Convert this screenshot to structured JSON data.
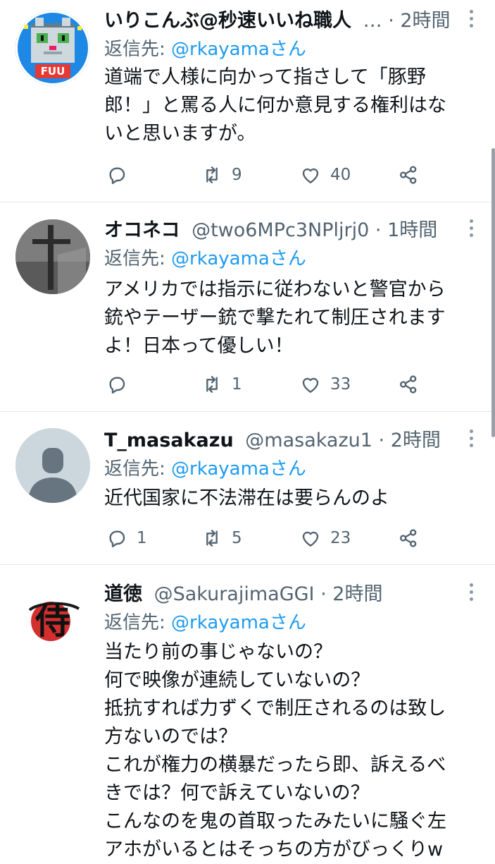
{
  "reply_prefix": "返信先: ",
  "tweets": [
    {
      "name": "いりこんぶ@秒速いいね職人",
      "handle": "…",
      "time": "2時間",
      "reply_to": "@rkayamaさん",
      "lines": [
        "道端で人様に向かって指さして「豚野",
        "郎！」と罵る人に何か意見する権利はな",
        "いと思いますが。"
      ],
      "reply_count": "",
      "retweet_count": "9",
      "like_count": "40"
    },
    {
      "name": "オコネコ",
      "handle": "@two6MPc3NPljrj0",
      "time": "1時間",
      "reply_to": "@rkayamaさん",
      "lines": [
        "アメリカでは指示に従わないと警官から",
        "銃やテーザー銃で撃たれて制圧されます",
        "よ！日本って優しい！"
      ],
      "reply_count": "",
      "retweet_count": "1",
      "like_count": "33"
    },
    {
      "name": "T_masakazu",
      "handle": "@masakazu1",
      "time": "2時間",
      "reply_to": "@rkayamaさん",
      "lines": [
        "近代国家に不法滞在は要らんのよ"
      ],
      "reply_count": "1",
      "retweet_count": "5",
      "like_count": "23"
    },
    {
      "name": "道徳",
      "handle": "@SakurajimaGGI",
      "time": "2時間",
      "reply_to": "@rkayamaさん",
      "lines": [
        "当たり前の事じゃないの？",
        "何で映像が連続していないの？",
        "抵抗すれば力ずくで制圧されるのは致し",
        "方ないのでは？",
        "これが権力の横暴だったら即、訴えるべ",
        "きでは？何で訴えていないの？",
        "こんなのを鬼の首取ったみたいに騒ぐ左",
        "アホがいるとはそっちの方がびっくりw"
      ]
    }
  ],
  "avatar1_text": "FUU",
  "avatar4_text": "侍",
  "colors": {
    "link": "#1d9bf0",
    "muted": "#536471",
    "separator": "#e1e8ed"
  },
  "icons": [
    "reply-icon",
    "retweet-icon",
    "like-icon",
    "share-icon",
    "more-icon"
  ]
}
